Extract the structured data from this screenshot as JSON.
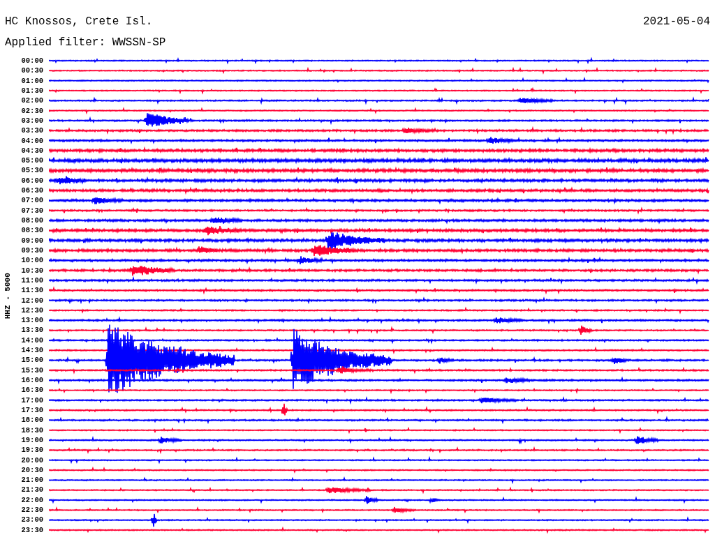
{
  "header": {
    "station": "HC Knossos, Crete Isl.",
    "date": "2021-05-04",
    "filter": "Applied filter: WWSSN-SP"
  },
  "axis_label": "HHZ - 5000",
  "traces": [
    {
      "time": "00:00",
      "color": "#0000ff"
    },
    {
      "time": "00:30",
      "color": "#ff0033"
    },
    {
      "time": "01:00",
      "color": "#0000ff"
    },
    {
      "time": "01:30",
      "color": "#ff0033"
    },
    {
      "time": "02:00",
      "color": "#0000ff"
    },
    {
      "time": "02:30",
      "color": "#ff0033"
    },
    {
      "time": "03:00",
      "color": "#0000ff"
    },
    {
      "time": "03:30",
      "color": "#ff0033"
    },
    {
      "time": "04:00",
      "color": "#0000ff"
    },
    {
      "time": "04:30",
      "color": "#ff0033"
    },
    {
      "time": "05:00",
      "color": "#0000ff"
    },
    {
      "time": "05:30",
      "color": "#ff0033"
    },
    {
      "time": "06:00",
      "color": "#0000ff"
    },
    {
      "time": "06:30",
      "color": "#ff0033"
    },
    {
      "time": "07:00",
      "color": "#0000ff"
    },
    {
      "time": "07:30",
      "color": "#ff0033"
    },
    {
      "time": "08:00",
      "color": "#0000ff"
    },
    {
      "time": "08:30",
      "color": "#ff0033"
    },
    {
      "time": "09:00",
      "color": "#0000ff"
    },
    {
      "time": "09:30",
      "color": "#ff0033"
    },
    {
      "time": "10:00",
      "color": "#0000ff"
    },
    {
      "time": "10:30",
      "color": "#ff0033"
    },
    {
      "time": "11:00",
      "color": "#0000ff"
    },
    {
      "time": "11:30",
      "color": "#ff0033"
    },
    {
      "time": "12:00",
      "color": "#0000ff"
    },
    {
      "time": "12:30",
      "color": "#ff0033"
    },
    {
      "time": "13:00",
      "color": "#0000ff"
    },
    {
      "time": "13:30",
      "color": "#ff0033"
    },
    {
      "time": "14:00",
      "color": "#0000ff"
    },
    {
      "time": "14:30",
      "color": "#ff0033"
    },
    {
      "time": "15:00",
      "color": "#0000ff"
    },
    {
      "time": "15:30",
      "color": "#ff0033"
    },
    {
      "time": "16:00",
      "color": "#0000ff"
    },
    {
      "time": "16:30",
      "color": "#ff0033"
    },
    {
      "time": "17:00",
      "color": "#0000ff"
    },
    {
      "time": "17:30",
      "color": "#ff0033"
    },
    {
      "time": "18:00",
      "color": "#0000ff"
    },
    {
      "time": "18:30",
      "color": "#ff0033"
    },
    {
      "time": "19:00",
      "color": "#0000ff"
    },
    {
      "time": "19:30",
      "color": "#ff0033"
    },
    {
      "time": "20:00",
      "color": "#0000ff"
    },
    {
      "time": "20:30",
      "color": "#ff0033"
    },
    {
      "time": "21:00",
      "color": "#0000ff"
    },
    {
      "time": "21:30",
      "color": "#ff0033"
    },
    {
      "time": "22:00",
      "color": "#0000ff"
    },
    {
      "time": "22:30",
      "color": "#ff0033"
    },
    {
      "time": "23:00",
      "color": "#0000ff"
    },
    {
      "time": "23:30",
      "color": "#ff0033"
    }
  ]
}
